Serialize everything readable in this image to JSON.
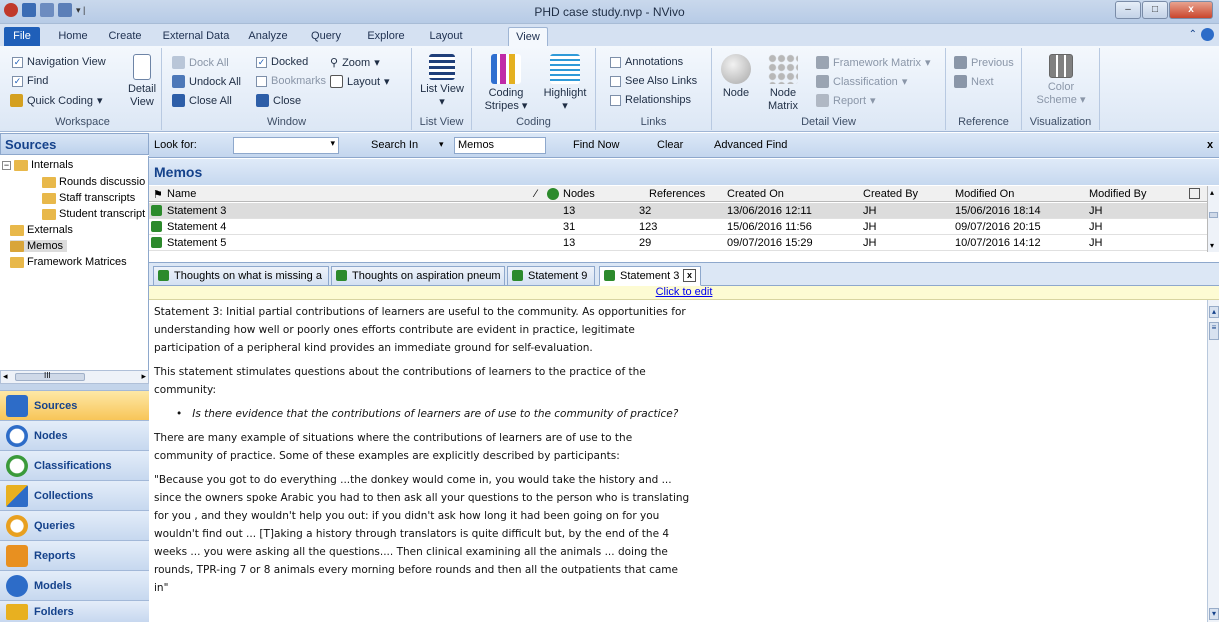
{
  "window": {
    "title": "PHD case study.nvp - NVivo",
    "minimize": "–",
    "maximize": "□",
    "close": "x"
  },
  "tabs": [
    "File",
    "Home",
    "Create",
    "External Data",
    "Analyze",
    "Query",
    "Explore",
    "Layout",
    "View"
  ],
  "ribbon": {
    "workspace": {
      "label": "Workspace",
      "navigation_view": "Navigation View",
      "find": "Find",
      "quick_coding": "Quick Coding",
      "detail_view": "Detail View"
    },
    "window": {
      "label": "Window",
      "dock_all": "Dock All",
      "undock_all": "Undock All",
      "close_all": "Close All",
      "docked": "Docked",
      "bookmarks": "Bookmarks",
      "close": "Close",
      "zoom": "Zoom",
      "layout": "Layout"
    },
    "list_view": {
      "label": "List View",
      "list_view_btn": "List View"
    },
    "coding": {
      "label": "Coding",
      "coding_stripes": "Coding Stripes",
      "highlight": "Highlight"
    },
    "links": {
      "label": "Links",
      "annotations": "Annotations",
      "see_also_links": "See Also Links",
      "relationships": "Relationships"
    },
    "detail_view": {
      "label": "Detail View",
      "node": "Node",
      "node_matrix": "Node Matrix",
      "framework_matrix": "Framework Matrix",
      "classification": "Classification",
      "report": "Report"
    },
    "reference": {
      "label": "Reference",
      "previous": "Previous",
      "next": "Next"
    },
    "visualization": {
      "label": "Visualization",
      "color_scheme": "Color Scheme"
    }
  },
  "sources_pane": {
    "title": "Sources",
    "tree": [
      {
        "label": "Internals",
        "level": 0
      },
      {
        "label": "Rounds discussio",
        "level": 2
      },
      {
        "label": "Staff transcripts",
        "level": 2
      },
      {
        "label": "Student transcript",
        "level": 2
      },
      {
        "label": "Externals",
        "level": 1
      },
      {
        "label": "Memos",
        "level": 1
      },
      {
        "label": "Framework Matrices",
        "level": 1
      }
    ],
    "scroll_text": "III"
  },
  "nav_buttons": [
    "Sources",
    "Nodes",
    "Classifications",
    "Collections",
    "Queries",
    "Reports",
    "Models",
    "Folders"
  ],
  "find_bar": {
    "look_for": "Look for:",
    "look_for_value": "",
    "search_in": "Search In",
    "search_in_value": "Memos",
    "find_now": "Find Now",
    "clear": "Clear",
    "advanced_find": "Advanced Find",
    "close": "x"
  },
  "memos": {
    "title": "Memos",
    "columns": [
      "Name",
      "Nodes",
      "References",
      "Created On",
      "Created By",
      "Modified On",
      "Modified By"
    ],
    "rows": [
      {
        "name": "Statement 3",
        "nodes": "13",
        "references": "32",
        "created_on": "13/06/2016 12:11",
        "created_by": "JH",
        "modified_on": "15/06/2016 18:14",
        "modified_by": "JH"
      },
      {
        "name": "Statement 4",
        "nodes": "31",
        "references": "123",
        "created_on": "15/06/2016 11:56",
        "created_by": "JH",
        "modified_on": "09/07/2016 20:15",
        "modified_by": "JH"
      },
      {
        "name": "Statement 5",
        "nodes": "13",
        "references": "29",
        "created_on": "09/07/2016 15:29",
        "created_by": "JH",
        "modified_on": "10/07/2016 14:12",
        "modified_by": "JH"
      }
    ]
  },
  "doc_tabs": [
    "Thoughts on what is missing a",
    "Thoughts on aspiration pneum",
    "Statement 9",
    "Statement 3"
  ],
  "doc_tab_close": "x",
  "click_to_edit": "Click to edit",
  "document": {
    "p1": "Statement 3: Initial partial contributions of learners are useful to the community.  As opportunities for understanding how well or poorly ones efforts contribute are evident in practice, legitimate participation of a peripheral kind provides an immediate ground for self-evaluation.",
    "p2": "This statement stimulates questions about the contributions of learners to the practice of the community:",
    "bullet": "Is there evidence that the contributions of learners are of use to the community of practice?",
    "p3": "There are many example of situations where the contributions of learners are of use to the community of practice.  Some of these examples are explicitly described by participants:",
    "p4": "\"Because you got to do everything ...the donkey would come in,  you would take the history and ... since the owners spoke Arabic you had to then ask all your questions to the person who is translating for you , and they wouldn't help you out: if you didn't ask how long it had been going on for you wouldn't find out ... [T]aking a history through translators is quite difficult but, by the end of the 4 weeks ... you were asking all the questions....  Then clinical examining all the animals ... doing the rounds, TPR-ing 7 or 8 animals every morning before rounds and then all the outpatients that came in\""
  }
}
